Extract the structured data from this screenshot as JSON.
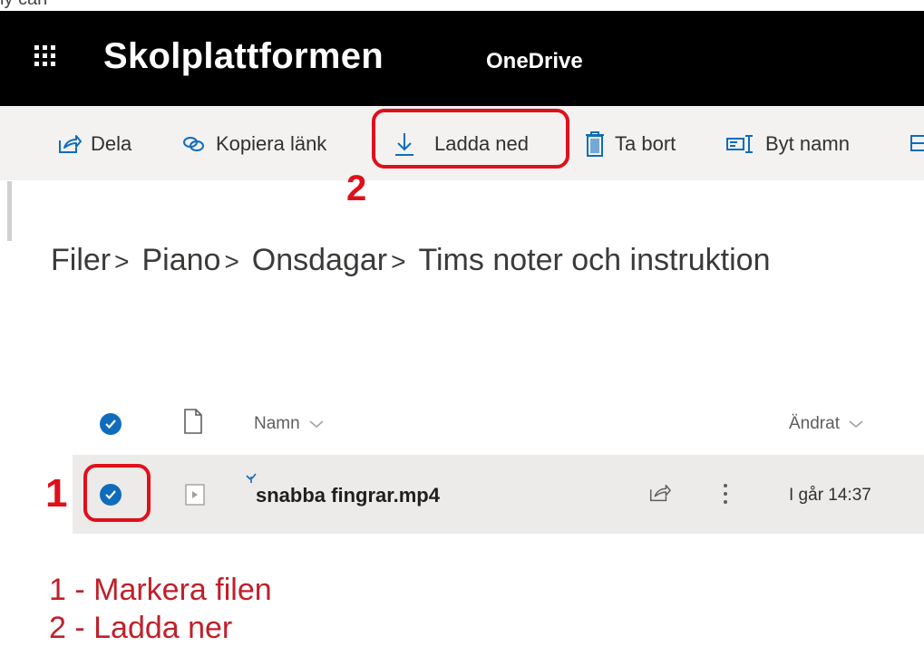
{
  "top_strip_text": "ly can",
  "app": {
    "brand": "Skolplattformen",
    "product": "OneDrive"
  },
  "commands": {
    "share": "Dela",
    "copy_link": "Kopiera länk",
    "download": "Ladda ned",
    "delete": "Ta bort",
    "rename": "Byt namn"
  },
  "breadcrumb": [
    "Filer",
    "Piano",
    "Onsdagar",
    "Tims noter och instruktion"
  ],
  "breadcrumb_sep": ">",
  "list": {
    "col_name": "Namn",
    "col_modified": "Ändrat",
    "files": [
      {
        "name": "snabba fingrar.mp4",
        "modified": "I går 14:37",
        "selected": true
      }
    ]
  },
  "annotations": {
    "num1": "1",
    "num2": "2",
    "legend": [
      "1 - Markera filen",
      "2 - Ladda ner"
    ],
    "color": "#e0101a"
  },
  "icons": [
    "waffle-icon",
    "share-icon",
    "link-icon",
    "download-icon",
    "trash-icon",
    "rename-icon",
    "check-circle-icon",
    "file-icon",
    "video-file-icon",
    "new-file-icon",
    "more-icon",
    "chevron-down-icon"
  ]
}
